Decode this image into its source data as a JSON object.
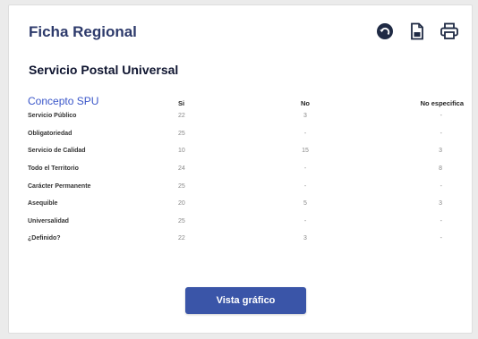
{
  "header": {
    "title": "Ficha Regional",
    "icons": [
      "back-icon",
      "document-icon",
      "print-icon"
    ]
  },
  "section": {
    "title": "Servicio Postal Universal"
  },
  "table": {
    "headers": [
      "Concepto SPU",
      "Si",
      "No",
      "No especifica"
    ],
    "rows": [
      [
        "Servicio Público",
        "22",
        "3",
        "-"
      ],
      [
        "Obligatoriedad",
        "25",
        "-",
        "-"
      ],
      [
        "Servicio de Calidad",
        "10",
        "15",
        "3"
      ],
      [
        "Todo el Territorio",
        "24",
        "-",
        "8"
      ],
      [
        "Carácter Permanente",
        "25",
        "-",
        "-"
      ],
      [
        "Asequible",
        "20",
        "5",
        "3"
      ],
      [
        "Universalidad",
        "25",
        "-",
        "-"
      ],
      [
        "¿Definido?",
        "22",
        "3",
        "-"
      ]
    ]
  },
  "actions": {
    "chart_button": "Vista gráfico"
  },
  "colors": {
    "accent": "#3a55a8",
    "title": "#2d3a6b",
    "header_link": "#3a56c9"
  }
}
